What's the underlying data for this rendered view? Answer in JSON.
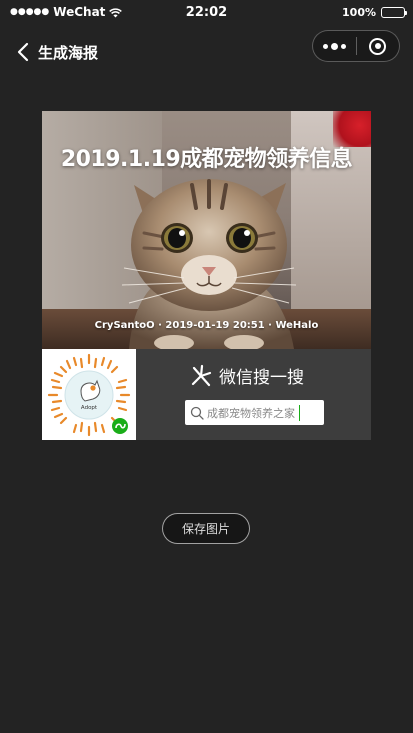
{
  "status_bar": {
    "carrier": "WeChat",
    "signal_dots": "●●●●●",
    "time": "22:02",
    "battery": "100%"
  },
  "nav": {
    "title": "生成海报"
  },
  "poster": {
    "title": "2019.1.19成都宠物领养信息",
    "credit": "CrySantoO · 2019-01-19 20:51 · WeHalo",
    "qr_caption": "Adopt",
    "wechat_search_label": "微信搜一搜",
    "search_text": "成都宠物领养之家"
  },
  "actions": {
    "save_label": "保存图片"
  },
  "colors": {
    "background": "#232323",
    "poster_bottom": "#3d3d3d",
    "accent_green": "#1aad19"
  }
}
